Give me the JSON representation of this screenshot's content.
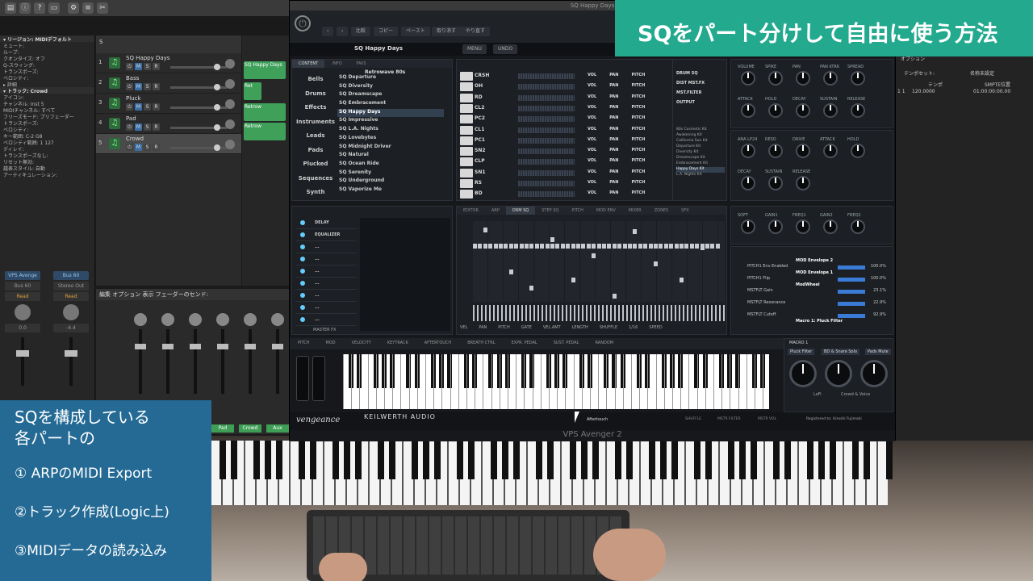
{
  "video_title": "SQをパート分けして自由に使う方法",
  "steps": {
    "heading_line1": "SQを構成している",
    "heading_line2": "各パートの",
    "items": [
      "① ARPのMIDI Export",
      "②トラック作成(Logic上)",
      "③MIDIデータの読み込み"
    ]
  },
  "logic": {
    "inspector_rows": [
      "▾ リージョン: MIDIデフォルト",
      "ミュート:",
      "ループ:",
      "クオンタイズ: オフ",
      "Q-スウィング:",
      "トランスポーズ:",
      "ベロシティ:",
      "▸ 詳細",
      "▾ トラック: Crowd",
      "アイコン:",
      "チャンネル: Inst 5",
      "MIDIチャンネル: すべて",
      "フリーズモード: プリフェーダー",
      "トランスポーズ:",
      "ベロシティ:",
      "キー範囲: C-2 G8",
      "ベロシティ範囲: 1 127",
      "ディレイ:",
      "トランスポーズなし:",
      "リセット無効:",
      "譜表スタイル: 自動",
      "アーティキュレーション:"
    ],
    "strip_left": {
      "plugin": "VPS Avenge",
      "out": "Bus 60",
      "mode": "Read",
      "val": "0.0"
    },
    "strip_right": {
      "plugin": "Bus 60",
      "out": "Stereo Out",
      "mode": "Read",
      "val1": "0.0",
      "val2": "-4.4"
    },
    "tracks_header": "S",
    "tracks": [
      {
        "num": "1",
        "name": "SQ Happy Days"
      },
      {
        "num": "2",
        "name": "Bass"
      },
      {
        "num": "3",
        "name": "Pluck"
      },
      {
        "num": "4",
        "name": "Pad"
      },
      {
        "num": "5",
        "name": "Crowd"
      }
    ],
    "regions": [
      "SQ Happy Days",
      "Ret",
      "Retrow",
      "Retrow"
    ],
    "mixer_menu": "編集   オプション   表示   フェーダーのセンド:",
    "mixer_labels": [
      "Pad",
      "Crowd",
      "Aux"
    ]
  },
  "avenger": {
    "window_title": "SQ Happy Days",
    "top_buttons": [
      "比較",
      "コピー",
      "ペースト",
      "取り消す",
      "やり直す"
    ],
    "preset_name": "SQ Happy Days",
    "preset_nav": [
      "MENU",
      "UNDO"
    ],
    "browser_tabs": [
      "CONTENT",
      "INFO",
      "FAVS"
    ],
    "browser_folder": "Retrowave 80s",
    "categories": [
      "Bells",
      "Drums",
      "Effects",
      "Instruments",
      "Leads",
      "Pads",
      "Plucked",
      "Sequences",
      "Synth"
    ],
    "presets": [
      "SQ Departure",
      "SQ Diversity",
      "SQ Dreamscape",
      "SQ Embracement",
      "SQ Happy Days",
      "SQ Impressive",
      "SQ L.A. Nights",
      "SQ Lovebytes",
      "SQ Midnight Driver",
      "SQ Natural",
      "SQ Ocean Ride",
      "SQ Serenity",
      "SQ Underground",
      "SQ Vaporize Me"
    ],
    "drum_rows": [
      "CRSH",
      "OH",
      "RD",
      "CL2",
      "PC2",
      "CL1",
      "PC1",
      "SN2",
      "CLP",
      "SN1",
      "RS",
      "BD"
    ],
    "drum_ctrl": [
      "VOL",
      "PAN",
      "PITCH"
    ],
    "route_items": [
      "DRUM SQ",
      "DIST MST.FX",
      "MST.FILTER",
      "OUTPUT"
    ],
    "kits": [
      "80s Cosmetic Kit",
      "Awakening Kit",
      "California Sun Kit",
      "Departure Kit",
      "Diversity Kit",
      "Dreamscape Kit",
      "Embracement Kit",
      "Happy Days Kit",
      "L.A. Nights Kit"
    ],
    "amp_labels": [
      "VOLUME",
      "SPIKE",
      "PAN",
      "PAN KTRK",
      "SPREAD",
      "ATTACK",
      "HOLD",
      "DECAY",
      "SUSTAIN",
      "RELEASE"
    ],
    "filter_labels": [
      "ANA LP24",
      "RESO",
      "DRIVE",
      "ATTACK",
      "HOLD",
      "DECAY",
      "SUSTAIN",
      "RELEASE"
    ],
    "fx_items": [
      "DELAY",
      "EQUALIZER",
      "...",
      "...",
      "...",
      "...",
      "...",
      "...",
      "..."
    ],
    "fx_footer": "MASTER FX",
    "seq_tabs": [
      "EDITOR",
      "ARP",
      "DRM SQ",
      "STEP SQ",
      "PITCH",
      "MOD ENV",
      "MIXER",
      "ZONES",
      "SFX"
    ],
    "seq_ctrls": [
      "VEL",
      "PAN",
      "PITCH",
      "GATE",
      "VEL.AMT",
      "LENGTH",
      "SHUFFLE",
      "1/16",
      "SPEED"
    ],
    "shaper_labels": [
      "SOFT",
      "GAIN1",
      "FREQ1",
      "GAIN2",
      "FREQ2"
    ],
    "mod_rows": [
      {
        "label": "MOD Envelope 2",
        "dest": "PITCH1 Env Enabled",
        "val": "100.0%"
      },
      {
        "label": "MOD Envelope 1",
        "dest": "PITCH1 Flip",
        "val": "100.0%"
      },
      {
        "label": "ModWheel",
        "dest": "MSTFLT Gain",
        "val": "23.1%"
      },
      {
        "label": "",
        "dest": "MSTFLT Resonance",
        "val": "22.9%"
      },
      {
        "label": "",
        "dest": "MSTFLT Cutoff",
        "val": "92.9%"
      },
      {
        "label": "Macro 1: Pluck Filter",
        "dest": "",
        "val": ""
      }
    ],
    "modbar": [
      "PITCH",
      "MOD",
      "VELOCITY",
      "KEYTRACK",
      "AFTERTOUCH",
      "BREATH CTRL",
      "EXPR. PEDAL",
      "SUST. PEDAL",
      "RANDOM"
    ],
    "macro_title": "MACRO 1",
    "macro_buttons": [
      "Pluck Filter",
      "BD & Snare Solo",
      "Pads Mute"
    ],
    "macro_sub": [
      "LoFi",
      "Crowd & Voice"
    ],
    "footer_logo": "vengeance",
    "footer_brand": "KEILWERTH AUDIO",
    "footer_status": "Aftertouch",
    "footer_btns": [
      "SHUFFLE",
      "MSTR FILTER",
      "MSTR VOL"
    ],
    "registered": "Registered to: Hiroshi Fujimaki",
    "plugin_name": "VPS Avenger 2"
  },
  "right_panel": {
    "menu": "オプション",
    "tempo_header": "テンポセット:",
    "tempo_name": "名称未設定",
    "col_tempo": "テンポ",
    "col_pos": "SMPTE位置",
    "row_bar": "1   1",
    "row_tempo": "120.0000",
    "row_pos": "01:00:00:00.00"
  },
  "colors": {
    "title_bg": "#22a98e",
    "steps_bg": "#246a94",
    "track_icon": "#2e6b3d"
  }
}
